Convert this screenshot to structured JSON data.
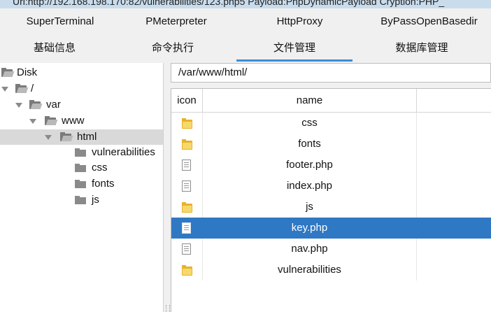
{
  "window": {
    "title": "Url:http://192.168.198.170:82/vulnerabilities/123.php5 Payload:PhpDynamicPayload Cryption:PHP_"
  },
  "tabs_top": [
    {
      "label": "SuperTerminal"
    },
    {
      "label": "PMeterpreter"
    },
    {
      "label": "HttpProxy"
    },
    {
      "label": "ByPassOpenBasedir"
    }
  ],
  "tabs_main": [
    {
      "label": "基础信息",
      "active": false
    },
    {
      "label": "命令执行",
      "active": false
    },
    {
      "label": "文件管理",
      "active": true
    },
    {
      "label": "数据库管理",
      "active": false
    }
  ],
  "tree": {
    "nodes": [
      {
        "label": "Disk",
        "icon": "folder-open-icon",
        "expanded": true
      },
      {
        "label": "/",
        "icon": "folder-open-icon",
        "expanded": true
      },
      {
        "label": "var",
        "icon": "folder-open-icon",
        "expanded": true
      },
      {
        "label": "www",
        "icon": "folder-open-icon",
        "expanded": true
      },
      {
        "label": "html",
        "icon": "folder-open-icon",
        "expanded": true,
        "selected": true
      },
      {
        "label": "vulnerabilities",
        "icon": "folder-icon"
      },
      {
        "label": "css",
        "icon": "folder-icon"
      },
      {
        "label": "fonts",
        "icon": "folder-icon"
      },
      {
        "label": "js",
        "icon": "folder-icon"
      }
    ]
  },
  "path": {
    "value": "/var/www/html/"
  },
  "file_table": {
    "columns": [
      "icon",
      "name"
    ],
    "rows": [
      {
        "name": "css",
        "type": "folder"
      },
      {
        "name": "fonts",
        "type": "folder"
      },
      {
        "name": "footer.php",
        "type": "file"
      },
      {
        "name": "index.php",
        "type": "file"
      },
      {
        "name": "js",
        "type": "folder"
      },
      {
        "name": "key.php",
        "type": "file",
        "selected": true
      },
      {
        "name": "nav.php",
        "type": "file"
      },
      {
        "name": "vulnerabilities",
        "type": "folder"
      }
    ]
  },
  "colors": {
    "selection": "#2f78c4",
    "active_tab_underline": "#3c8dd8",
    "folder": "#e8b22b"
  }
}
